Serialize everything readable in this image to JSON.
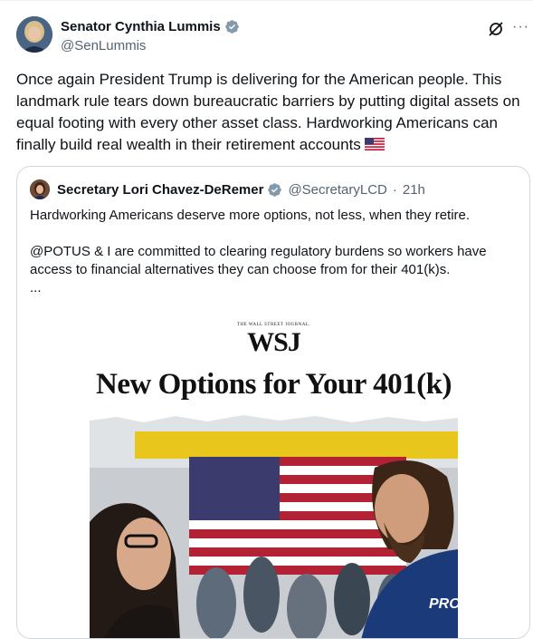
{
  "tweet": {
    "author_name": "Senator Cynthia Lummis",
    "author_handle": "@SenLummis",
    "text": "Once again President Trump is delivering for the American people. This landmark rule tears down bureaucratic barriers by putting digital assets on equal footing with every other asset class. Hardworking Americans can finally build real wealth in their retirement accounts",
    "verified": true,
    "actions": {
      "grok_icon": "grok-icon",
      "more_icon": "more-icon",
      "more_label": "···"
    }
  },
  "quoted_tweet": {
    "author_name": "Secretary Lori Chavez-DeRemer",
    "author_handle": "@SecretaryLCD",
    "separator": "·",
    "time": "21h",
    "verified": true,
    "line1": "Hardworking Americans deserve more options, not less, when they retire.",
    "line2": "@POTUS & I are committed to clearing regulatory burdens so workers have access to financial alternatives they can choose from for their 401(k)s.",
    "ellipsis": "...",
    "media": {
      "masthead_small": "THE WALL STREET JOURNAL.",
      "masthead": "WSJ",
      "headline": "New Options for Your 401(k)",
      "photo_shirt_text": "PRO"
    }
  },
  "colors": {
    "verified_blue": "#1d9bf0",
    "text_primary": "#0f1419",
    "text_secondary": "#536471",
    "border": "#cfd9de"
  }
}
